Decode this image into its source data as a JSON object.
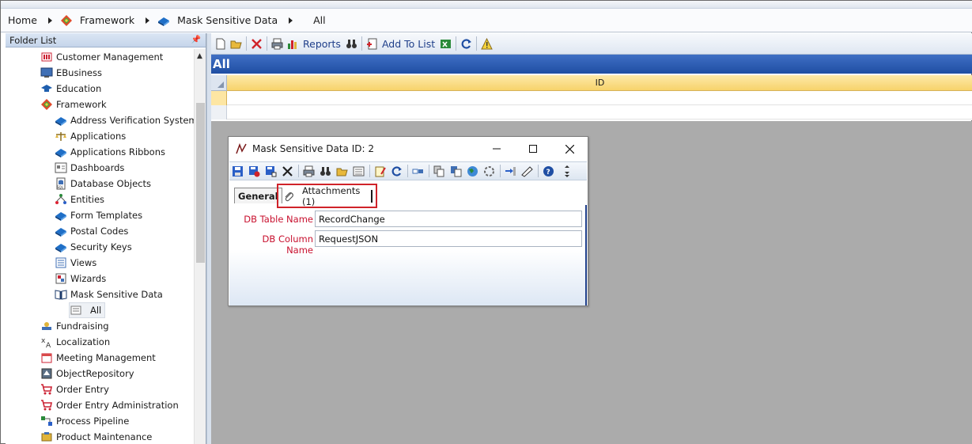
{
  "breadcrumb": {
    "items": [
      {
        "label": "Home",
        "icon": "home-icon"
      },
      {
        "label": "Framework",
        "icon": "framework-icon"
      },
      {
        "label": "Mask Sensitive Data",
        "icon": "book-icon"
      },
      {
        "label": "All",
        "icon": ""
      }
    ]
  },
  "folder_list": {
    "title": "Folder List",
    "items": [
      {
        "label": "Customer Management",
        "icon": "customer-icon"
      },
      {
        "label": "EBusiness",
        "icon": "monitor-icon"
      },
      {
        "label": "Education",
        "icon": "graduation-cap-icon"
      },
      {
        "label": "Framework",
        "icon": "framework-icon"
      },
      {
        "label": "Address Verification Systems",
        "icon": "book-icon"
      },
      {
        "label": "Applications",
        "icon": "scales-icon"
      },
      {
        "label": "Applications Ribbons",
        "icon": "book-icon"
      },
      {
        "label": "Dashboards",
        "icon": "dashboard-icon"
      },
      {
        "label": "Database Objects",
        "icon": "sql-icon"
      },
      {
        "label": "Entities",
        "icon": "entities-icon"
      },
      {
        "label": "Form Templates",
        "icon": "book-icon"
      },
      {
        "label": "Postal Codes",
        "icon": "book-icon"
      },
      {
        "label": "Security Keys",
        "icon": "book-icon"
      },
      {
        "label": "Views",
        "icon": "views-icon"
      },
      {
        "label": "Wizards",
        "icon": "wizard-icon"
      },
      {
        "label": "Mask Sensitive Data",
        "icon": "open-book-icon"
      },
      {
        "label": "All",
        "icon": "list-icon"
      },
      {
        "label": "Fundraising",
        "icon": "fundraising-icon"
      },
      {
        "label": "Localization",
        "icon": "localization-icon"
      },
      {
        "label": "Meeting Management",
        "icon": "calendar-icon"
      },
      {
        "label": "ObjectRepository",
        "icon": "repository-icon"
      },
      {
        "label": "Order Entry",
        "icon": "cart-icon"
      },
      {
        "label": "Order Entry Administration",
        "icon": "cart-icon"
      },
      {
        "label": "Process Pipeline",
        "icon": "pipeline-icon"
      },
      {
        "label": "Product Maintenance",
        "icon": "product-icon"
      }
    ]
  },
  "main_toolbar": {
    "reports_label": "Reports",
    "add_to_list_label": "Add To List"
  },
  "view": {
    "title": "All",
    "grid": {
      "columns": [
        "ID"
      ]
    }
  },
  "dialog": {
    "title": "Mask Sensitive Data ID: 2",
    "tabs": {
      "general": "General",
      "attachments": "Attachments (1)"
    },
    "fields": [
      {
        "label": "DB Table Name",
        "value": "RecordChange"
      },
      {
        "label": "DB Column Name",
        "value": "RequestJSON"
      }
    ]
  },
  "colors": {
    "accent": "#1f4ea3",
    "highlight": "#d0232a",
    "grid_header": "#f7d36b",
    "field_label": "#c8102e"
  }
}
